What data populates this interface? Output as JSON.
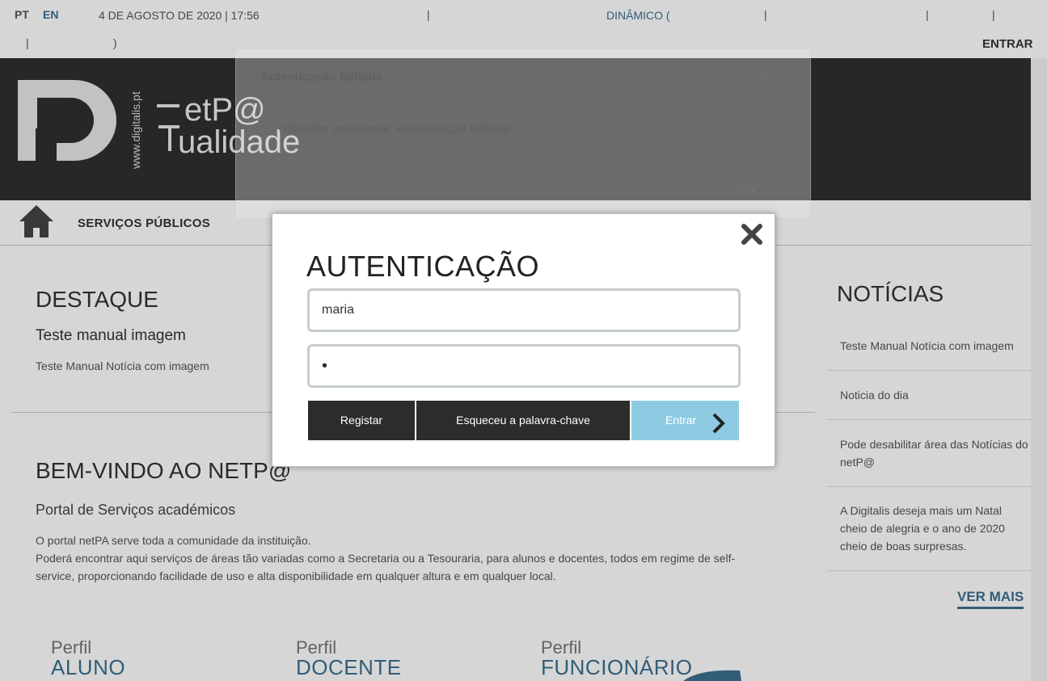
{
  "topbar": {
    "lang_pt": "PT",
    "lang_en": "EN",
    "datetime": "4 DE AGOSTO DE 2020 | 17:56",
    "sep1": "|",
    "dynamic": "DINÂMICO (",
    "sep2": "|",
    "sep3": "|",
    "sep4": "|",
    "sep5": "|",
    "paren_close": ")",
    "login": "ENTRAR"
  },
  "logo": {
    "site": "www.digitalis.pt",
    "line1": "etP@",
    "line2": "ualidade"
  },
  "nav": {
    "services": "SERVIÇOS PÚBLICOS"
  },
  "destaque": {
    "title": "DESTAQUE",
    "subtitle": "Teste manual imagem",
    "text": "Teste Manual Notícia com imagem"
  },
  "welcome": {
    "title": "BEM-VINDO AO NETP@",
    "subtitle": "Portal de Serviços académicos",
    "p1": "O portal netPA serve toda a comunidade da instituição.",
    "p2": "Poderá encontrar aqui serviços de áreas tão variadas como a Secretaria ou a Tesouraria, para alunos e docentes, todos em regime de self-",
    "p3": "service, proporcionando facilidade de uso e alta disponibilidade em qualquer altura e em qualquer local."
  },
  "perfis": [
    {
      "a": "Perfil",
      "b": "ALUNO"
    },
    {
      "a": "Perfil",
      "b": "DOCENTE"
    },
    {
      "a": "Perfil",
      "b": "FUNCIONÁRIO"
    }
  ],
  "news": {
    "title": "NOTÍCIAS",
    "items": [
      "Teste Manual Notícia com imagem",
      "Noticia do dia",
      "Pode desabilitar área das Notícias do netP@",
      "A Digitalis deseja mais um Natal cheio de alegria e o ano de 2020 cheio de boas surpresas."
    ],
    "more": "VER MAIS"
  },
  "error_dialog": {
    "title": "Autenticação falhada",
    "close": "×",
    "message": "Utilizador inexistente. Autenticação falhada",
    "ok": "OK"
  },
  "auth": {
    "title": "AUTENTICAÇÃO",
    "username": "maria",
    "password_mask": "•",
    "register": "Registar",
    "forgot": "Esqueceu a palavra-chave",
    "submit": "Entrar"
  },
  "colors": {
    "accent": "#3b6f8f",
    "submit_bg": "#8ecbe3",
    "dark_button": "#2c2c2c",
    "header_bg": "#2f2f2f"
  }
}
